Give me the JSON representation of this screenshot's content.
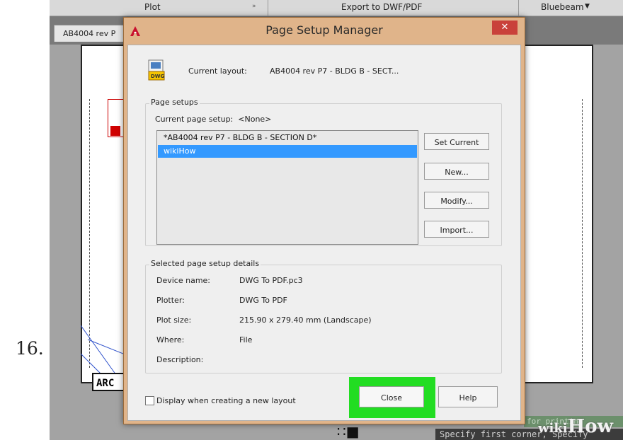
{
  "step_number": "16.",
  "ribbon": {
    "plot_label": "Plot",
    "plot_arrow": "»",
    "export_label": "Export to DWF/PDF",
    "bluebeam_label": "Bluebeam",
    "bluebeam_arrow": "▼"
  },
  "doc_tab": {
    "label": "AB4004 rev P"
  },
  "drawing": {
    "arc_label": "ARC",
    "command_text": "Specify first corner, Specify",
    "command_hint": "for printing",
    "watermark_wiki": "wiki",
    "watermark_how": "How"
  },
  "dialog": {
    "title": "Page Setup Manager",
    "close_symbol": "✕",
    "current_layout_label": "Current layout:",
    "current_layout_value": "AB4004 rev P7 - BLDG B - SECT...",
    "layout_icon_text": "DWG",
    "page_setups": {
      "legend": "Page setups",
      "current_page_setup_label": "Current page setup:",
      "current_page_setup_value": "<None>",
      "items": [
        "*AB4004 rev P7 - BLDG B - SECTION D*",
        "wikiHow"
      ],
      "selected_index": 1
    },
    "buttons": {
      "set_current": "Set Current",
      "new": "New...",
      "modify": "Modify...",
      "import": "Import..."
    },
    "details": {
      "legend": "Selected page setup details",
      "rows": [
        {
          "label": "Device name:",
          "value": "DWG To PDF.pc3"
        },
        {
          "label": "Plotter:",
          "value": "DWG To PDF"
        },
        {
          "label": "Plot size:",
          "value": "215.90 x 279.40 mm (Landscape)"
        },
        {
          "label": "Where:",
          "value": "File"
        },
        {
          "label": "Description:",
          "value": ""
        }
      ]
    },
    "display_checkbox_label": "Display when creating a new layout",
    "display_checkbox_checked": false,
    "close_button": "Close",
    "help_button": "Help"
  },
  "colors": {
    "dialog_frame": "#e0b48a",
    "selection": "#3399ff",
    "highlight": "#22dd22",
    "close_red": "#c9413a"
  }
}
